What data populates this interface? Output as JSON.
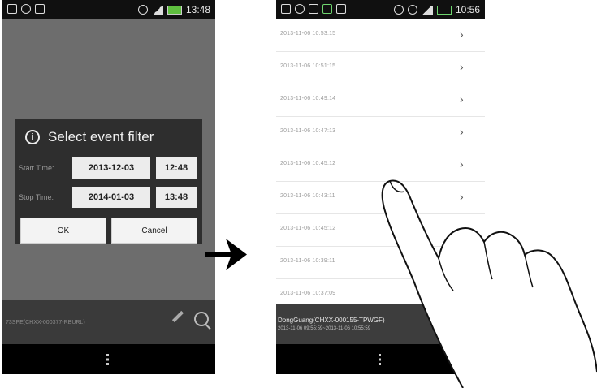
{
  "left_phone": {
    "status_time": "13:48",
    "dialog": {
      "title": "Select event filter",
      "start_label": "Start Time:",
      "start_date": "2013-12-03",
      "start_time": "12:48",
      "stop_label": "Stop Time:",
      "stop_date": "2014-01-03",
      "stop_time": "13:48",
      "ok_label": "OK",
      "cancel_label": "Cancel"
    },
    "bottom_text": "73SPE(CHXX-000377-RBURL)"
  },
  "right_phone": {
    "status_time": "10:56",
    "events": [
      "2013-11-06 10:53:15",
      "2013-11-06 10:51:15",
      "2013-11-06 10:49:14",
      "2013-11-06 10:47:13",
      "2013-11-06 10:45:12",
      "2013-11-06 10:43:11",
      "2013-11-06 10:45:12",
      "2013-11-06 10:39:11",
      "2013-11-06 10:37:09"
    ],
    "bottom_title": "DongGuang(CHXX-000155-TPWGF)",
    "bottom_range": "2013-11-06 09:55:59~2013-11-06 10:55:59"
  },
  "colors": {
    "dialog_bg": "#2e2e2e",
    "list_bg": "#ffffff",
    "battery": "#5fbf3f"
  }
}
